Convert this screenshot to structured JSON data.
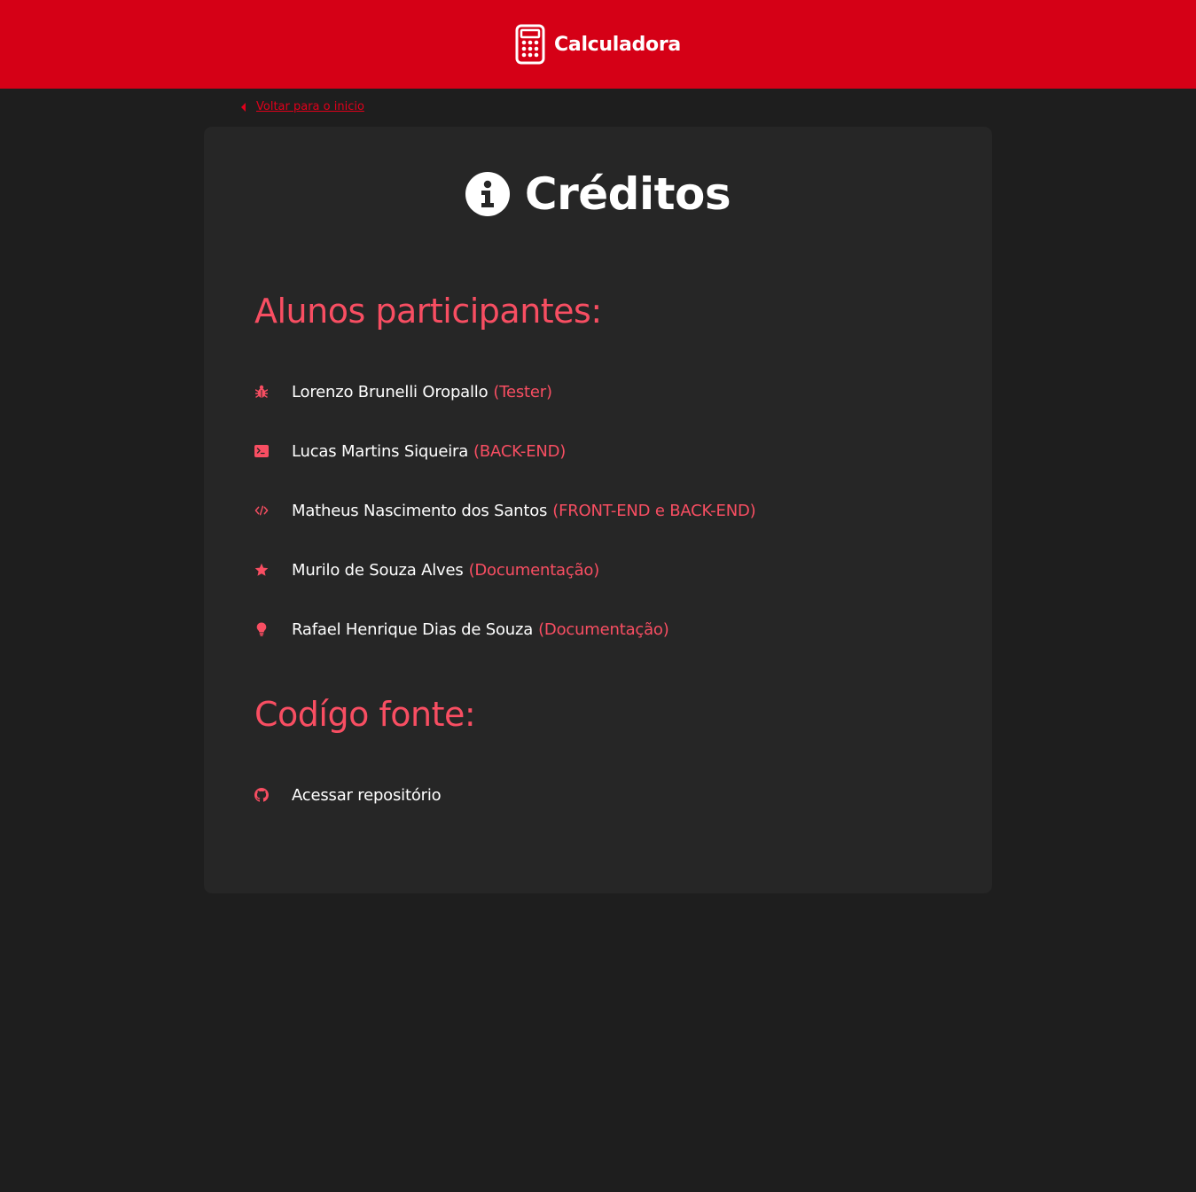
{
  "header": {
    "brand_icon": "calculator-icon",
    "title": "Calculadora",
    "background_color": "#d50016"
  },
  "back_link": {
    "icon": "caret-left-icon",
    "label": "Voltar para o inicio",
    "color": "#e0001b"
  },
  "card": {
    "title_icon": "info-circle-icon",
    "title": "Créditos"
  },
  "students": {
    "heading": "Alunos participantes:",
    "items": [
      {
        "icon": "bug-icon",
        "name": "Lorenzo Brunelli Oropallo",
        "role": "(Tester)"
      },
      {
        "icon": "terminal-icon",
        "name": "Lucas Martins Siqueira",
        "role": "(BACK-END)"
      },
      {
        "icon": "code-icon",
        "name": "Matheus Nascimento dos Santos",
        "role": "(FRONT-END e BACK-END)"
      },
      {
        "icon": "star-icon",
        "name": "Murilo de Souza Alves",
        "role": "(Documentação)"
      },
      {
        "icon": "lightbulb-icon",
        "name": "Rafael Henrique Dias de Souza",
        "role": "(Documentação)"
      }
    ]
  },
  "source": {
    "heading": "Codígo fonte:",
    "link_icon": "github-icon",
    "link_label": "Acessar repositório"
  },
  "colors": {
    "accent": "#f84e62",
    "page_background": "#1e1e1e",
    "card_background": "#262626",
    "text": "#ffffff"
  }
}
